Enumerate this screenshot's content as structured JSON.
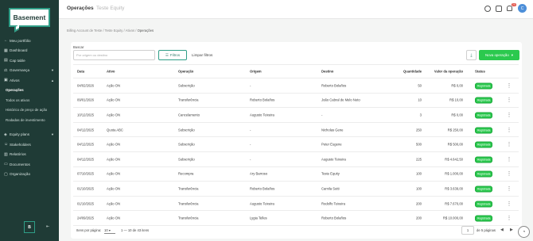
{
  "sidebar": {
    "logo": "Basement",
    "items": [
      {
        "label": "Meu portfólio",
        "icon": "arrow-left-icon"
      },
      {
        "label": "Dashboard",
        "icon": "dashboard-icon"
      },
      {
        "label": "Cap table",
        "icon": "table-icon"
      },
      {
        "label": "Governança",
        "icon": "governance-icon"
      },
      {
        "label": "Ativos",
        "icon": "assets-icon"
      }
    ],
    "ativos_sub": [
      "Operações",
      "Todos os ativos",
      "Histórico de preço de ação",
      "Rodadas de investimento"
    ],
    "items2": [
      {
        "label": "Equity plans",
        "icon": "equity-icon"
      },
      {
        "label": "Stakeholders",
        "icon": "stakeholders-icon"
      },
      {
        "label": "Relatórios",
        "icon": "reports-icon"
      },
      {
        "label": "Documentos",
        "icon": "documents-icon"
      },
      {
        "label": "Organização",
        "icon": "organization-icon"
      }
    ],
    "footer_logo": "B",
    "collapse_icon": "⇤"
  },
  "topbar": {
    "title": "Operações",
    "subtitle": "Teste Equity",
    "notifications_count": "20",
    "avatar": "C"
  },
  "breadcrumb": [
    "Billing Account de Teste",
    "Teste Equity",
    "Ativos",
    "Operações"
  ],
  "toolbar": {
    "search_label": "Buscar",
    "search_placeholder": "Por origem ou destino",
    "filter_label": "Filtros",
    "clear_label": "Limpar filtros",
    "new_label": "Nova operação"
  },
  "table": {
    "headers": {
      "data": "Data",
      "ativo": "Ativo",
      "operacao": "Operação",
      "origem": "Origem",
      "destino": "Destino",
      "quantidade": "Quantidade",
      "valor": "Valor da operação",
      "status": "Status"
    },
    "rows": [
      {
        "data": "04/02/2026",
        "ativo": "Ação ON",
        "operacao": "Subscrição",
        "origem": "-",
        "destino": "Roberto Bolaños",
        "quantidade": "50",
        "valor": "R$ 0,00",
        "status": "Registrada"
      },
      {
        "data": "09/01/2026",
        "ativo": "Ação ON",
        "operacao": "Transferência",
        "origem": "Roberto Bolaños",
        "destino": "João Cabral de Melo Neto",
        "quantidade": "10",
        "valor": "R$ 10,00",
        "status": "Registrada"
      },
      {
        "data": "10/12/2025",
        "ativo": "Ação ON",
        "operacao": "Cancelamento",
        "origem": "Augusto Teixeira",
        "destino": "-",
        "quantidade": "3",
        "valor": "R$ 0,00",
        "status": "Registrada"
      },
      {
        "data": "04/12/2025",
        "ativo": "Quota ABC",
        "operacao": "Subscrição",
        "origem": "-",
        "destino": "Nicholas Gene",
        "quantidade": "250",
        "valor": "R$ 250,00",
        "status": "Registrada"
      },
      {
        "data": "04/12/2025",
        "ativo": "Ação ON",
        "operacao": "Subscrição",
        "origem": "-",
        "destino": "Peter Eugene",
        "quantidade": "500",
        "valor": "R$ 500,00",
        "status": "Registrada"
      },
      {
        "data": "04/12/2025",
        "ativo": "Ação ON",
        "operacao": "Subscrição",
        "origem": "-",
        "destino": "Augusto Teixeira",
        "quantidade": "225",
        "valor": "R$ 4.642,50",
        "status": "Registrada"
      },
      {
        "data": "07/10/2025",
        "ativo": "Ação ON",
        "operacao": "Recompra",
        "origem": "Ary Barroso",
        "destino": "Teste Equity",
        "quantidade": "100",
        "valor": "R$ 1.000,00",
        "status": "Registrada"
      },
      {
        "data": "01/10/2025",
        "ativo": "Ação ON",
        "operacao": "Transferência",
        "origem": "Roberto Bolaños",
        "destino": "Camila Sutti",
        "quantidade": "100",
        "valor": "R$ 3.639,00",
        "status": "Registrada"
      },
      {
        "data": "01/10/2025",
        "ativo": "Ação ON",
        "operacao": "Transferência",
        "origem": "Augusto Teixeira",
        "destino": "Rodolfo Teixeira",
        "quantidade": "200",
        "valor": "R$ 7.670,00",
        "status": "Registrada"
      },
      {
        "data": "24/09/2025",
        "ativo": "Ação ON",
        "operacao": "Transferência",
        "origem": "Lygia Telles",
        "destino": "Roberto Bolaños",
        "quantidade": "200",
        "valor": "R$ 10.000,00",
        "status": "Registrada"
      }
    ]
  },
  "pagination": {
    "items_per_page_label": "Itens por página:",
    "items_per_page": "10",
    "range": "1 — 10 de 43 itens",
    "page": "1",
    "of_pages": "de 5 páginas"
  },
  "colors": {
    "sidebar": "#1f3b36",
    "accent": "#2bc94e",
    "logo_border": "#2f9e87"
  }
}
